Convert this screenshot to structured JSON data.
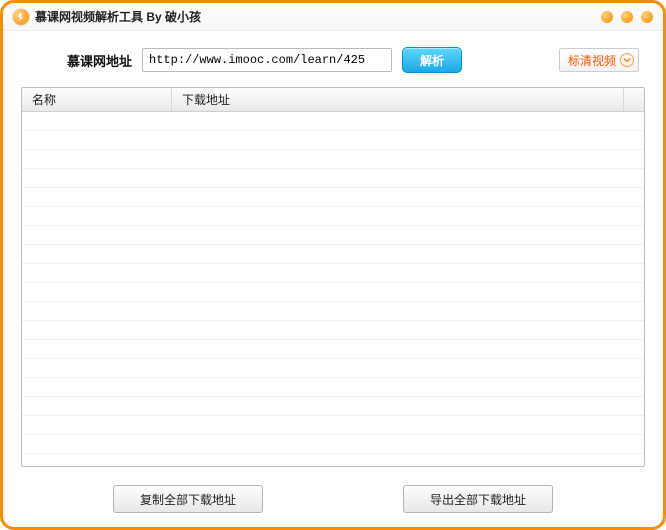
{
  "window": {
    "title": "慕课网视频解析工具 By 破小孩"
  },
  "topbar": {
    "url_label": "慕课网地址",
    "url_value": "http://www.imooc.com/learn/425",
    "parse_label": "解析",
    "quality_label": "标清视频"
  },
  "grid": {
    "col_name": "名称",
    "col_url": "下载地址",
    "rows": []
  },
  "bottom": {
    "copy_all": "复制全部下载地址",
    "export_all": "导出全部下载地址"
  }
}
